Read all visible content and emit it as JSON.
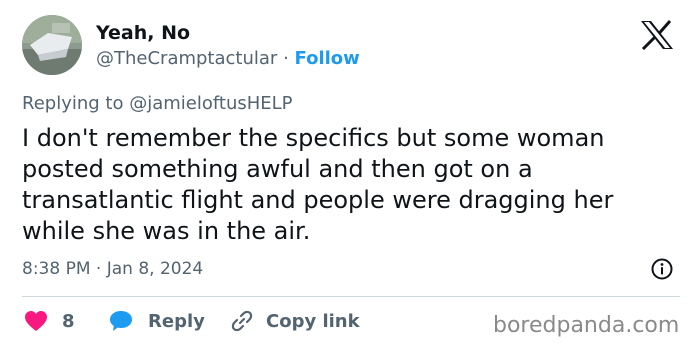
{
  "author": {
    "display_name": "Yeah, No",
    "handle": "@TheCramptactular",
    "separator": "·",
    "follow_label": "Follow"
  },
  "reply": {
    "prefix": "Replying to",
    "mention": "@jamieloftusHELP"
  },
  "tweet": {
    "text": "I don't remember the specifics but some woman posted something awful and then got on a transatlantic flight and people were dragging her while she was in the air.",
    "timestamp": "8:38 PM · Jan 8, 2024"
  },
  "actions": {
    "like_count": "8",
    "reply_label": "Reply",
    "copy_label": "Copy link"
  },
  "watermark": "boredpanda.com",
  "colors": {
    "link": "#1d9bf0",
    "like": "#f91880",
    "secondary_text": "#536471"
  }
}
